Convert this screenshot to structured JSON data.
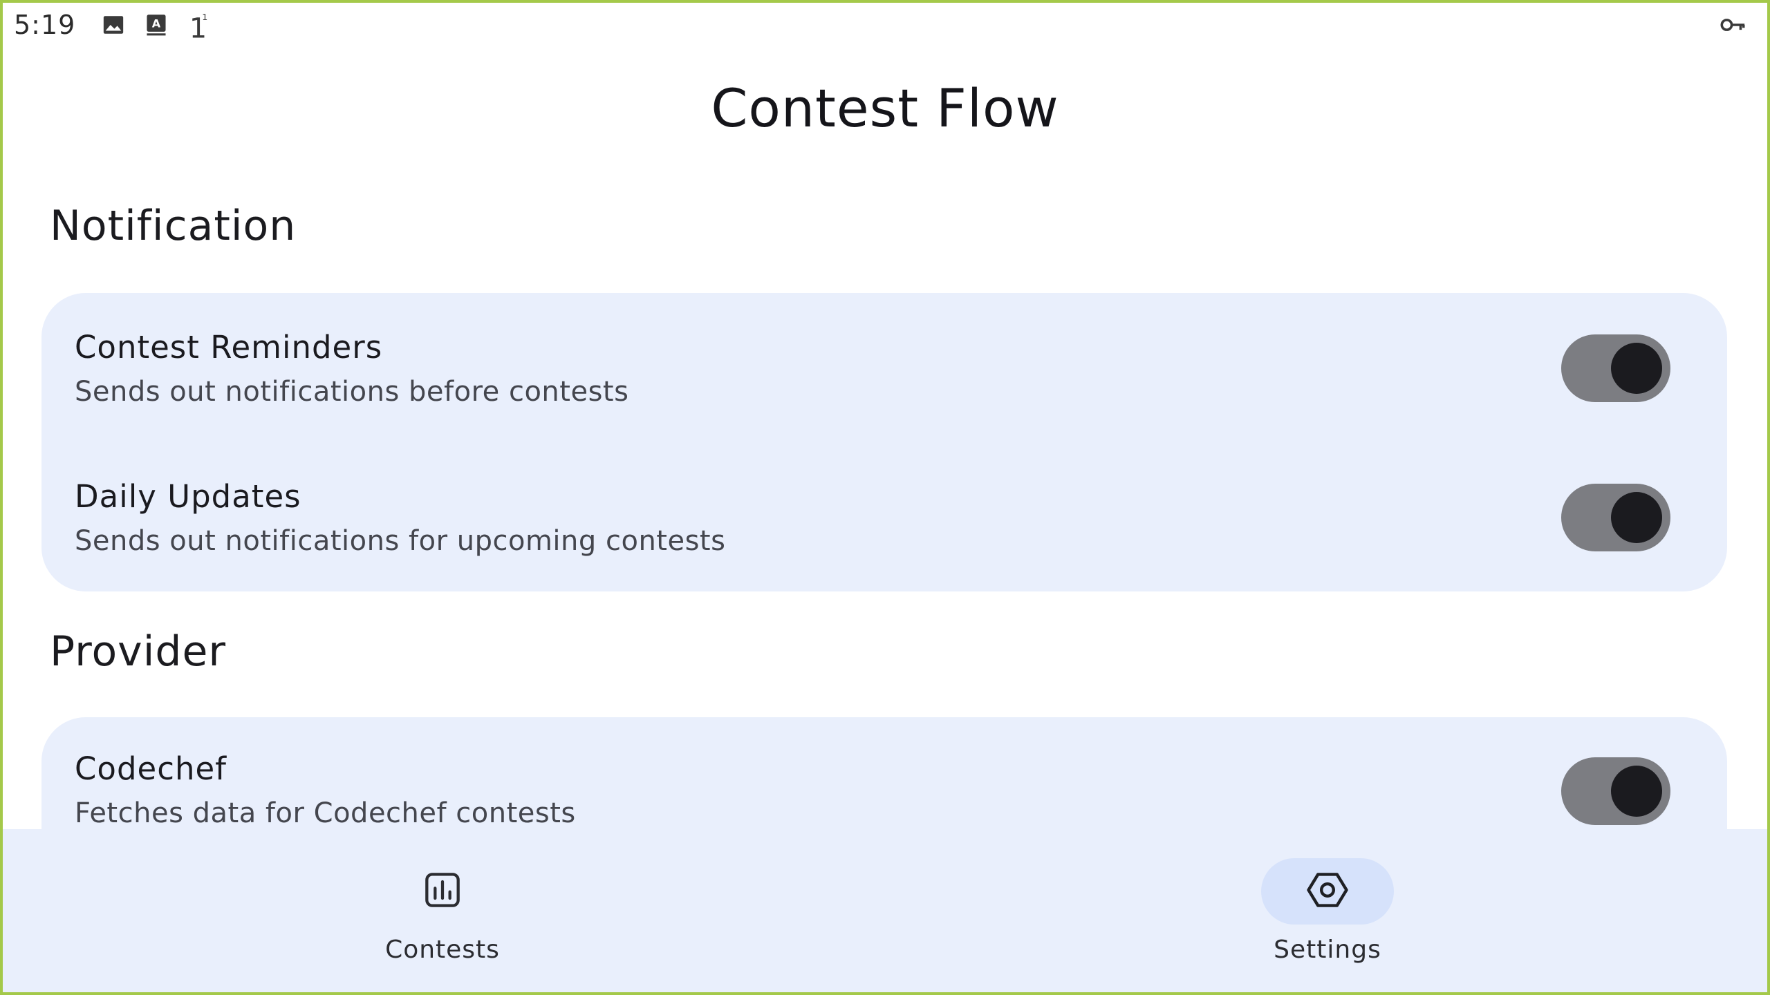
{
  "status_bar": {
    "time": "5:19",
    "icons": [
      "image-icon",
      "keyboard-a-icon",
      "one-notification-icon"
    ],
    "notification_count": "1",
    "right_icons": [
      "vpn-key-icon"
    ]
  },
  "app_bar": {
    "title": "Contest Flow"
  },
  "sections": {
    "notification": {
      "title": "Notification",
      "items": [
        {
          "title": "Contest Reminders",
          "description": "Sends out notifications before contests",
          "enabled": true
        },
        {
          "title": "Daily Updates",
          "description": "Sends out notifications for upcoming contests",
          "enabled": true
        }
      ]
    },
    "provider": {
      "title": "Provider",
      "items": [
        {
          "title": "Codechef",
          "description": "Fetches data for Codechef contests",
          "enabled": true
        }
      ]
    }
  },
  "bottom_nav": {
    "items": [
      {
        "label": "Contests",
        "icon": "bar-chart-icon",
        "selected": false
      },
      {
        "label": "Settings",
        "icon": "settings-hexagon-icon",
        "selected": true
      }
    ]
  },
  "colors": {
    "card_background": "#e9effc",
    "nav_background": "#e9effc",
    "nav_active_pill": "#d6e2fb",
    "switch_track": "#7c7d82",
    "switch_thumb": "#1b1b1f",
    "frame_border": "#a4c94a"
  }
}
